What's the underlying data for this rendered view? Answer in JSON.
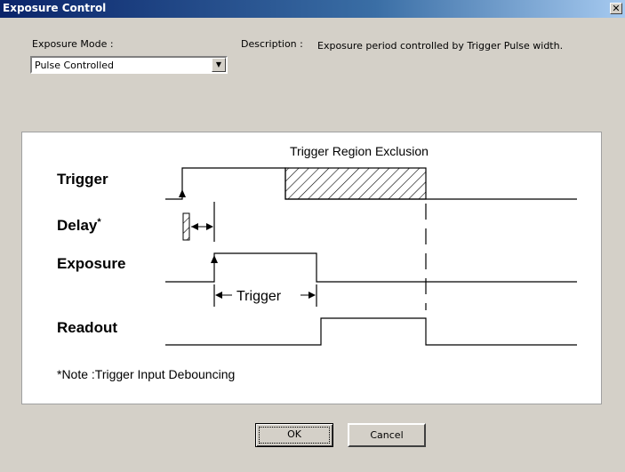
{
  "window": {
    "title": "Exposure Control",
    "close_glyph": "✕"
  },
  "form": {
    "mode_label": "Exposure Mode :",
    "mode_value": "Pulse Controlled",
    "description_label": "Description :",
    "description_text": "Exposure period controlled by Trigger Pulse width."
  },
  "diagram": {
    "region_label": "Trigger Region Exclusion",
    "signals": {
      "trigger": "Trigger",
      "delay": "Delay",
      "delay_marker": "*",
      "exposure": "Exposure",
      "readout": "Readout"
    },
    "span_label": "Trigger",
    "note": "*Note :Trigger Input Debouncing"
  },
  "buttons": {
    "ok": "OK",
    "cancel": "Cancel"
  }
}
